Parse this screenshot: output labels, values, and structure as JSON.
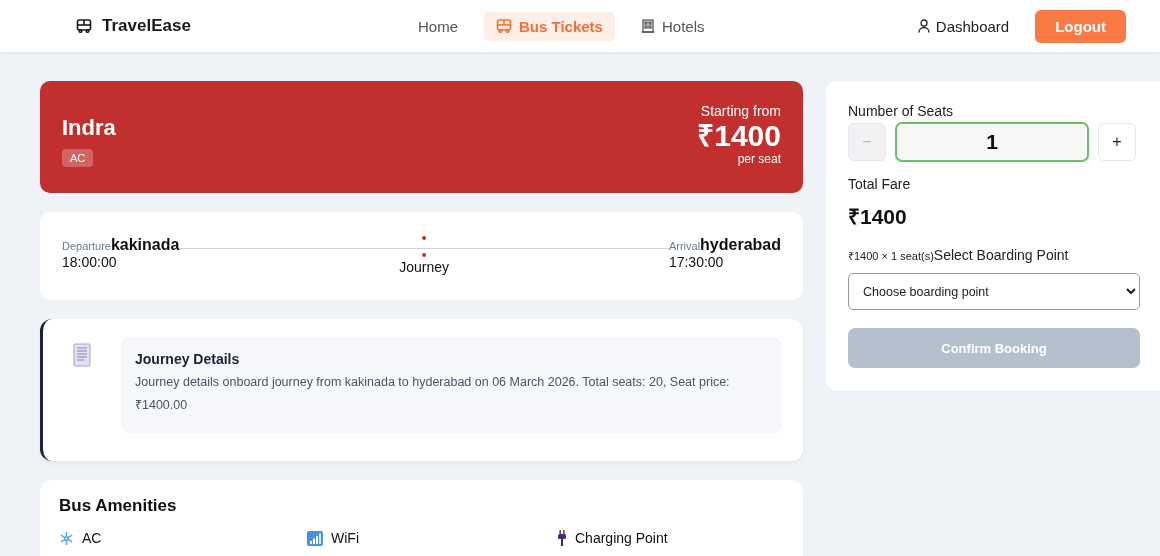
{
  "header": {
    "brand": "TravelEase",
    "nav": [
      {
        "label": "Home",
        "kind": "plain",
        "selected": false
      },
      {
        "label": "Bus Tickets",
        "kind": "bus",
        "selected": true
      },
      {
        "label": "Hotels",
        "kind": "hotel",
        "selected": false
      }
    ],
    "dashboard": "Dashboard",
    "logout": "Logout"
  },
  "bus": {
    "name": "Indra",
    "tag": "AC",
    "price_label": "Starting from",
    "price": "₹1400",
    "per": "per seat"
  },
  "route": {
    "departure_label": "Departure",
    "from": "kakinada",
    "departure_time": "18:00:00",
    "middle": "Journey",
    "arrival_label": "Arrival",
    "to": "hyderabad",
    "arrival_time": "17:30:00"
  },
  "details": {
    "title": "Journey Details",
    "text": "Journey details onboard journey from kakinada to hyderabad on 06 March 2026. Total seats: 20, Seat price: ₹1400.00"
  },
  "amenities": {
    "title": "Bus Amenities",
    "items": [
      {
        "label": "AC",
        "kind": "snow"
      },
      {
        "label": "WiFi",
        "kind": "wifi"
      },
      {
        "label": "Charging Point",
        "kind": "plug"
      }
    ]
  },
  "booking": {
    "seats_label": "Number of Seats",
    "minus": "−",
    "minus_disabled": true,
    "seats": "1",
    "plus": "+",
    "total_label": "Total Fare",
    "total": "₹1400",
    "breakdown": "₹1400 × 1 seat(s)",
    "boarding_label": "Select Boarding Point",
    "boarding_placeholder": "Choose boarding point",
    "confirm": "Confirm Booking",
    "confirm_disabled": true
  }
}
